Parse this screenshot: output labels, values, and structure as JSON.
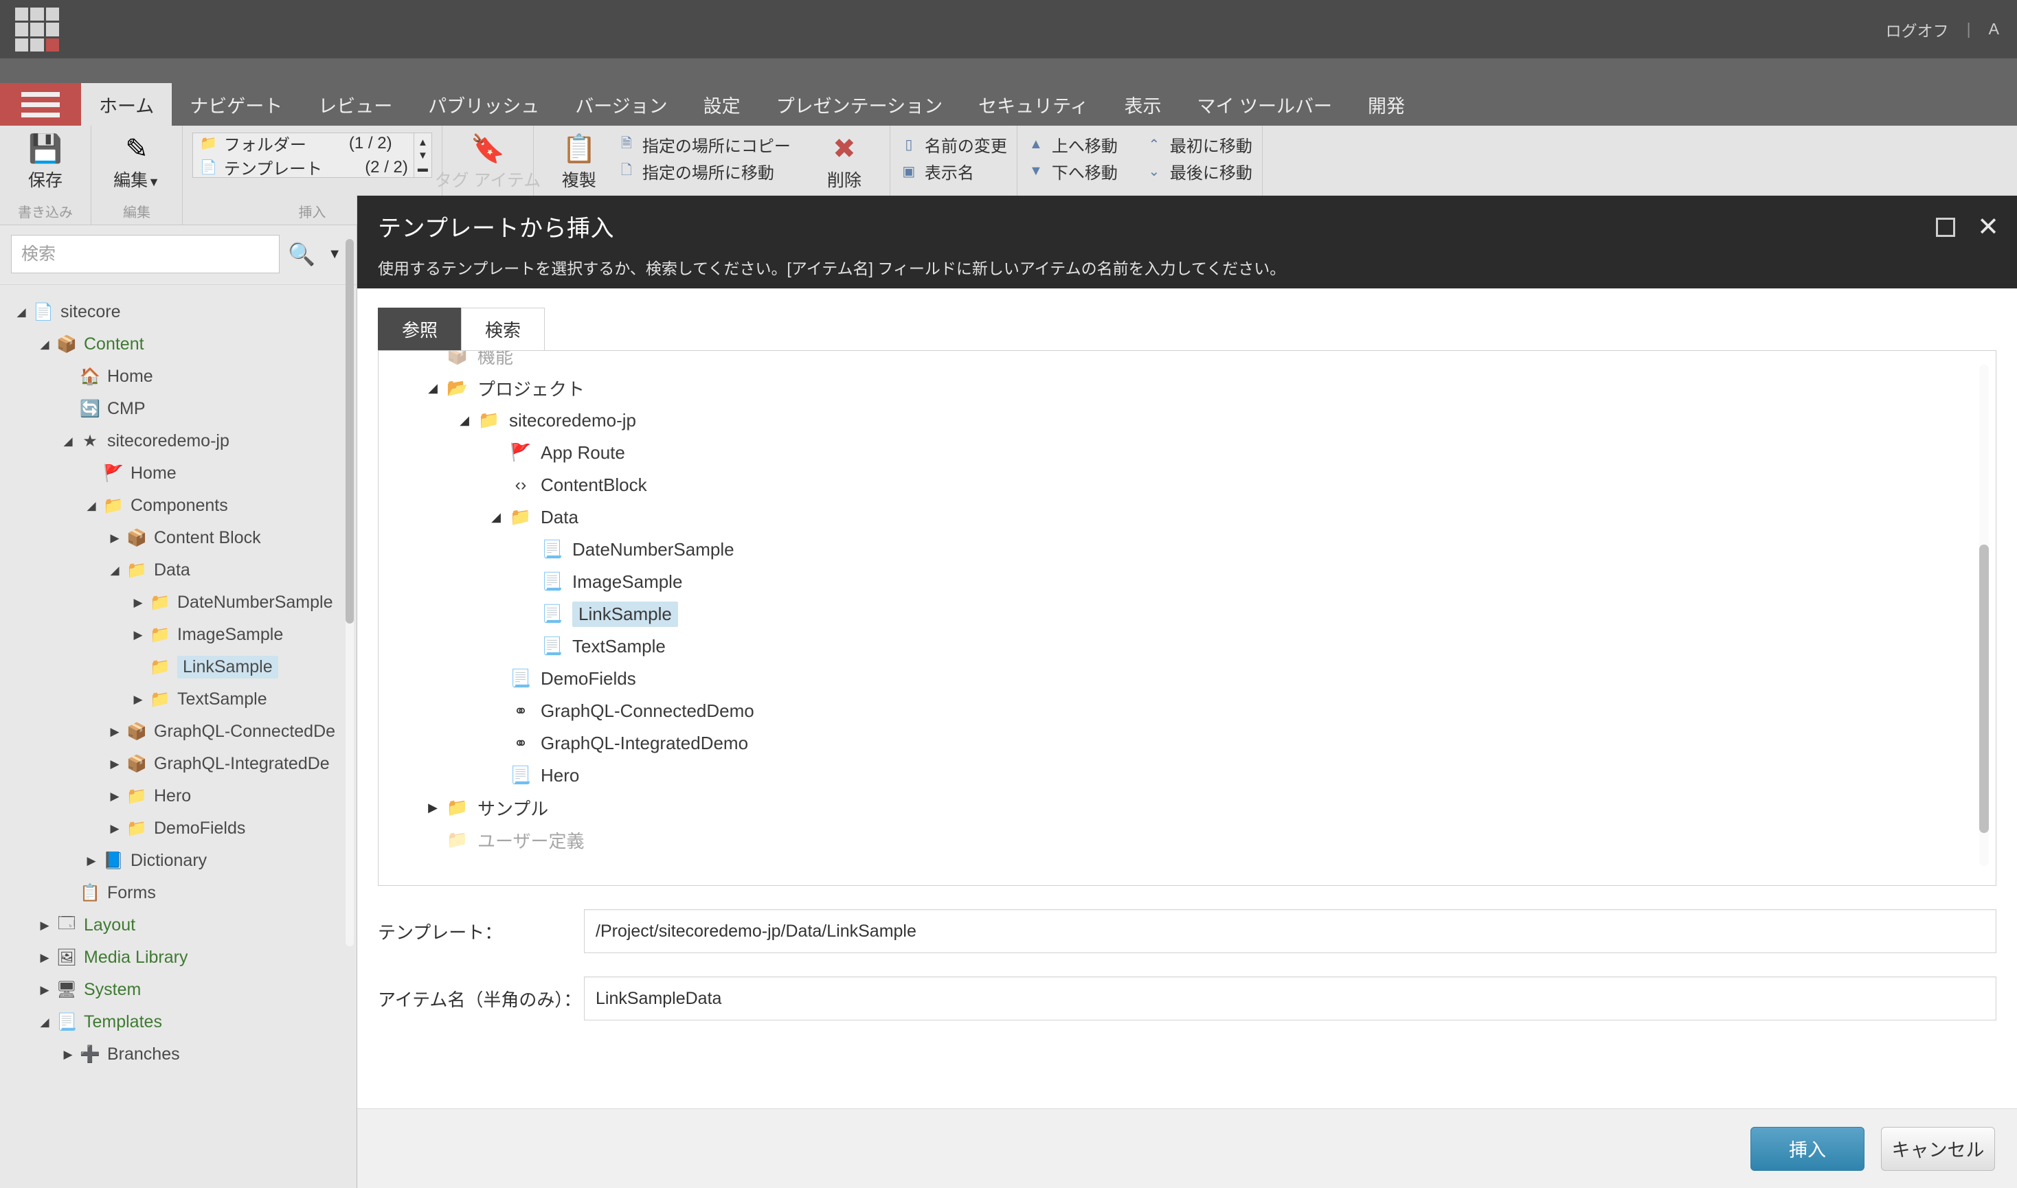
{
  "globalbar": {
    "logoff_label": "ログオフ",
    "separator": "|",
    "user_label": "A"
  },
  "ribbon_tabs": [
    {
      "label": "ホーム",
      "active": true
    },
    {
      "label": "ナビゲート",
      "active": false
    },
    {
      "label": "レビュー",
      "active": false
    },
    {
      "label": "パブリッシュ",
      "active": false
    },
    {
      "label": "バージョン",
      "active": false
    },
    {
      "label": "設定",
      "active": false
    },
    {
      "label": "プレゼンテーション",
      "active": false
    },
    {
      "label": "セキュリティ",
      "active": false
    },
    {
      "label": "表示",
      "active": false
    },
    {
      "label": "マイ ツールバー",
      "active": false
    },
    {
      "label": "開発",
      "active": false
    }
  ],
  "ribbon": {
    "group_write": {
      "label": "書き込み",
      "save_button": "保存",
      "save_icon": "save-icon"
    },
    "group_edit": {
      "label": "編集",
      "edit_button": "編集",
      "edit_icon": "edit-pencil-icon"
    },
    "group_insert": {
      "label": "挿入",
      "rows": [
        {
          "icon": "folder-icon",
          "label": "フォルダー",
          "count": "(1 / 2)"
        },
        {
          "icon": "template-icon",
          "label": "テンプレート",
          "count": "(2 / 2)"
        }
      ],
      "tag_item_label": "タグ アイテム",
      "tag_icon": "tag-icon"
    },
    "group_operations": {
      "duplicate_label": "複製",
      "duplicate_icon": "duplicate-icon",
      "copy_to_label": "指定の場所にコピー",
      "move_to_label": "指定の場所に移動",
      "delete_label": "削除",
      "delete_icon": "delete-x-icon"
    },
    "group_rename": {
      "rename_label": "名前の変更",
      "display_name_label": "表示名"
    },
    "group_sorting": {
      "move_up_label": "上へ移動",
      "move_down_label": "下へ移動",
      "move_first_label": "最初に移動",
      "move_last_label": "最後に移動"
    }
  },
  "sidebar": {
    "search_placeholder": "検索",
    "search_value": "",
    "search_icon": "search-icon",
    "dropdown_icon": "chevron-down-icon",
    "tree": [
      {
        "label": "sitecore",
        "depth": 0,
        "twisty": "open",
        "icon": "document-icon",
        "selected": false,
        "green": false
      },
      {
        "label": "Content",
        "depth": 1,
        "twisty": "open",
        "icon": "content-icon",
        "selected": false,
        "green": true
      },
      {
        "label": "Home",
        "depth": 2,
        "twisty": "none",
        "icon": "home-icon",
        "selected": false,
        "green": false
      },
      {
        "label": "CMP",
        "depth": 2,
        "twisty": "none",
        "icon": "sync-icon",
        "selected": false,
        "green": false
      },
      {
        "label": "sitecoredemo-jp",
        "depth": 2,
        "twisty": "open",
        "icon": "site-star-icon",
        "selected": false,
        "green": false
      },
      {
        "label": "Home",
        "depth": 3,
        "twisty": "none",
        "icon": "route-icon",
        "selected": false,
        "green": false
      },
      {
        "label": "Components",
        "depth": 3,
        "twisty": "open",
        "icon": "folder-icon",
        "selected": false,
        "green": false
      },
      {
        "label": "Content Block",
        "depth": 4,
        "twisty": "closed",
        "icon": "package-icon",
        "selected": false,
        "green": false
      },
      {
        "label": "Data",
        "depth": 4,
        "twisty": "open",
        "icon": "folder-icon",
        "selected": false,
        "green": false
      },
      {
        "label": "DateNumberSample",
        "depth": 5,
        "twisty": "closed",
        "icon": "folder-icon",
        "selected": false,
        "green": false
      },
      {
        "label": "ImageSample",
        "depth": 5,
        "twisty": "closed",
        "icon": "folder-icon",
        "selected": false,
        "green": false
      },
      {
        "label": "LinkSample",
        "depth": 5,
        "twisty": "none",
        "icon": "folder-icon",
        "selected": true,
        "green": false
      },
      {
        "label": "TextSample",
        "depth": 5,
        "twisty": "closed",
        "icon": "folder-icon",
        "selected": false,
        "green": false
      },
      {
        "label": "GraphQL-ConnectedDe",
        "depth": 4,
        "twisty": "closed",
        "icon": "package-icon",
        "selected": false,
        "green": false
      },
      {
        "label": "GraphQL-IntegratedDe",
        "depth": 4,
        "twisty": "closed",
        "icon": "package-icon",
        "selected": false,
        "green": false
      },
      {
        "label": "Hero",
        "depth": 4,
        "twisty": "closed",
        "icon": "folder-icon",
        "selected": false,
        "green": false
      },
      {
        "label": "DemoFields",
        "depth": 4,
        "twisty": "closed",
        "icon": "folder-icon",
        "selected": false,
        "green": false
      },
      {
        "label": "Dictionary",
        "depth": 3,
        "twisty": "closed",
        "icon": "book-icon",
        "selected": false,
        "green": false
      },
      {
        "label": "Forms",
        "depth": 2,
        "twisty": "none",
        "icon": "forms-icon",
        "selected": false,
        "green": false
      },
      {
        "label": "Layout",
        "depth": 1,
        "twisty": "closed",
        "icon": "layout-icon",
        "selected": false,
        "green": true
      },
      {
        "label": "Media Library",
        "depth": 1,
        "twisty": "closed",
        "icon": "media-icon",
        "selected": false,
        "green": true
      },
      {
        "label": "System",
        "depth": 1,
        "twisty": "closed",
        "icon": "system-icon",
        "selected": false,
        "green": true
      },
      {
        "label": "Templates",
        "depth": 1,
        "twisty": "open",
        "icon": "template-icon",
        "selected": false,
        "green": true
      },
      {
        "label": "Branches",
        "depth": 2,
        "twisty": "closed",
        "icon": "branches-icon",
        "selected": false,
        "green": false
      }
    ]
  },
  "dialog": {
    "title": "テンプレートから挿入",
    "subtitle": "使用するテンプレートを選択するか、検索してください。[アイテム名] フィールドに新しいアイテムの名前を入力してください。",
    "maximize_icon": "maximize-icon",
    "close_icon": "close-icon",
    "tabs": [
      {
        "label": "参照",
        "active": true
      },
      {
        "label": "検索",
        "active": false
      }
    ],
    "tree": [
      {
        "label": "機能",
        "depth": 1,
        "twisty": "none",
        "icon": "module-icon",
        "selected": false,
        "faded": true
      },
      {
        "label": "プロジェクト",
        "depth": 1,
        "twisty": "open",
        "icon": "project-icon",
        "selected": false,
        "faded": false
      },
      {
        "label": "sitecoredemo-jp",
        "depth": 2,
        "twisty": "open",
        "icon": "folder-icon",
        "selected": false,
        "faded": false
      },
      {
        "label": "App Route",
        "depth": 3,
        "twisty": "none",
        "icon": "route-icon",
        "selected": false,
        "faded": false
      },
      {
        "label": "ContentBlock",
        "depth": 3,
        "twisty": "none",
        "icon": "code-doc-icon",
        "selected": false,
        "faded": false
      },
      {
        "label": "Data",
        "depth": 3,
        "twisty": "open",
        "icon": "folder-icon",
        "selected": false,
        "faded": false
      },
      {
        "label": "DateNumberSample",
        "depth": 4,
        "twisty": "none",
        "icon": "template-icon",
        "selected": false,
        "faded": false
      },
      {
        "label": "ImageSample",
        "depth": 4,
        "twisty": "none",
        "icon": "template-icon",
        "selected": false,
        "faded": false
      },
      {
        "label": "LinkSample",
        "depth": 4,
        "twisty": "none",
        "icon": "template-icon",
        "selected": true,
        "faded": false
      },
      {
        "label": "TextSample",
        "depth": 4,
        "twisty": "none",
        "icon": "template-icon",
        "selected": false,
        "faded": false
      },
      {
        "label": "DemoFields",
        "depth": 3,
        "twisty": "none",
        "icon": "template-icon",
        "selected": false,
        "faded": false
      },
      {
        "label": "GraphQL-ConnectedDemo",
        "depth": 3,
        "twisty": "none",
        "icon": "link-icon",
        "selected": false,
        "faded": false
      },
      {
        "label": "GraphQL-IntegratedDemo",
        "depth": 3,
        "twisty": "none",
        "icon": "link-icon",
        "selected": false,
        "faded": false
      },
      {
        "label": "Hero",
        "depth": 3,
        "twisty": "none",
        "icon": "template-icon",
        "selected": false,
        "faded": false
      },
      {
        "label": "サンプル",
        "depth": 1,
        "twisty": "closed",
        "icon": "folder-icon",
        "selected": false,
        "faded": false
      },
      {
        "label": "ユーザー定義",
        "depth": 1,
        "twisty": "none",
        "icon": "folder-icon",
        "selected": false,
        "faded": true
      }
    ],
    "fields": {
      "template_label": "テンプレート：",
      "template_value": "/Project/sitecoredemo-jp/Data/LinkSample",
      "itemname_label": "アイテム名（半角のみ）：",
      "itemname_value": "LinkSampleData"
    },
    "buttons": {
      "insert_label": "挿入",
      "cancel_label": "キャンセル"
    }
  },
  "colors": {
    "accent_red": "#c0504d",
    "dark_chrome": "#4b4b4b",
    "modal_header": "#2b2b2b",
    "selection_blue": "#cde3ef",
    "primary_button": "#2f84ad",
    "green_text": "#3f7a32"
  }
}
